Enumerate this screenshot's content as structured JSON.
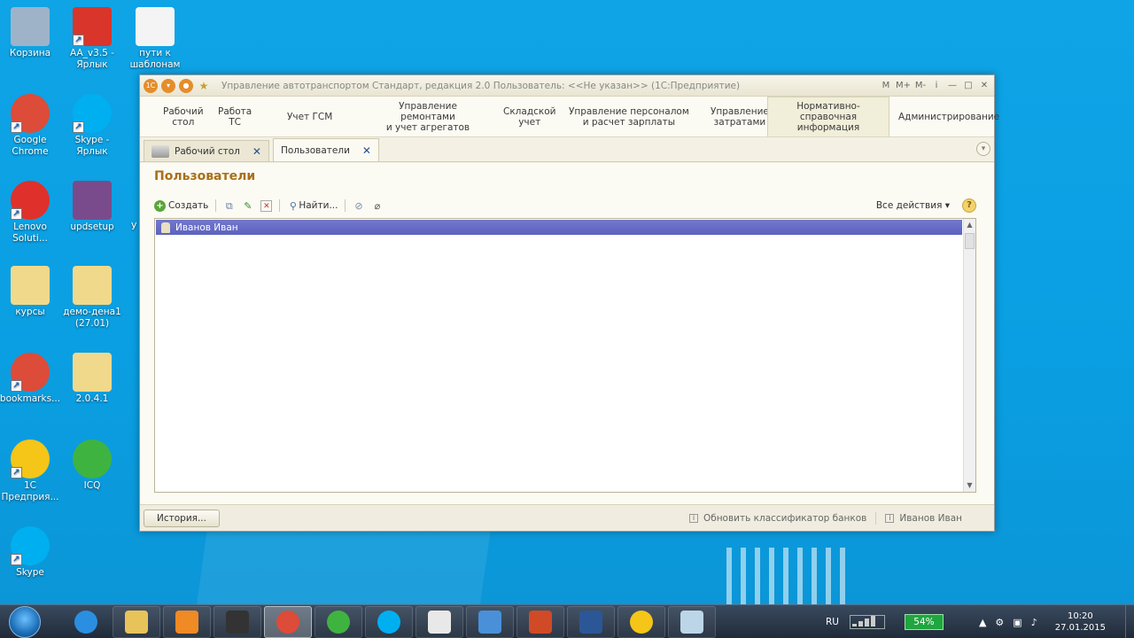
{
  "desktop": {
    "icons": [
      {
        "id": "recycle",
        "label": "Корзина",
        "color": "#9fb3c8"
      },
      {
        "id": "aa",
        "label": "AA_v3.5 -\nЯрлык",
        "color": "#d9352b"
      },
      {
        "id": "paths",
        "label": "пути к\nшаблонам",
        "color": "#f4f4f4"
      },
      {
        "id": "chrome",
        "label": "Google\nChrome",
        "color": "#dd4b39"
      },
      {
        "id": "skype1",
        "label": "Skype -\nЯрлык",
        "color": "#00aff0"
      },
      {
        "id": "lenovo",
        "label": "Lenovo\nSoluti...",
        "color": "#e0302c"
      },
      {
        "id": "updsetup",
        "label": "updsetup",
        "color": "#7a4b8c"
      },
      {
        "id": "kursy",
        "label": "курсы",
        "color": "#f1d98b"
      },
      {
        "id": "demo",
        "label": "демо-дена1\n(27.01)",
        "color": "#f1d98b"
      },
      {
        "id": "bookmarks",
        "label": "bookmarks...",
        "color": "#dd4b39"
      },
      {
        "id": "folder204",
        "label": "2.0.4.1",
        "color": "#f1d98b"
      },
      {
        "id": "onec",
        "label": "1С\nПредприя...",
        "color": "#f5c518"
      },
      {
        "id": "icq",
        "label": "ICQ",
        "color": "#3fb33f"
      },
      {
        "id": "skype2",
        "label": "Skype",
        "color": "#00aff0"
      }
    ],
    "partial_label": "У"
  },
  "window": {
    "title": "Управление автотранспортом Стандарт, редакция 2.0   Пользователь: <<Не указан>>  (1С:Предприятие)",
    "title_tools": [
      "M",
      "M+",
      "M-",
      "i",
      "—",
      "□",
      "✕"
    ],
    "sections": [
      {
        "label": "Рабочий\nстол",
        "active": false
      },
      {
        "label": "Работа\nТС",
        "active": false
      },
      {
        "label": "Учет ГСМ",
        "active": false
      },
      {
        "label": "Управление ремонтами\nи учет агрегатов",
        "active": false
      },
      {
        "label": "Складской\nучет",
        "active": false
      },
      {
        "label": "Управление персоналом\nи расчет зарплаты",
        "active": false
      },
      {
        "label": "Управление\nзатратами",
        "active": false
      },
      {
        "label": "Нормативно-справочная\nинформация",
        "active": true
      },
      {
        "label": "Администрирование",
        "active": false
      }
    ],
    "tabs": [
      {
        "label": "Рабочий стол",
        "active": false
      },
      {
        "label": "Пользователи",
        "active": true
      }
    ],
    "form": {
      "title": "Пользователи",
      "commands": {
        "create": "Создать",
        "find": "Найти...",
        "all_actions": "Все действия ▾",
        "help": "?"
      },
      "rows": [
        "Иванов Иван"
      ]
    },
    "status": {
      "history": "История...",
      "update_banks": "Обновить классификатор банков",
      "user": "Иванов Иван"
    }
  },
  "taskbar": {
    "apps": [
      {
        "id": "ie",
        "color": "#2a8fe0"
      },
      {
        "id": "explorer",
        "color": "#e8c35a"
      },
      {
        "id": "media",
        "color": "#f08a24"
      },
      {
        "id": "app-dark",
        "color": "#333333"
      },
      {
        "id": "chrome",
        "color": "#dd4b39"
      },
      {
        "id": "icq",
        "color": "#3fb33f"
      },
      {
        "id": "skype",
        "color": "#00aff0"
      },
      {
        "id": "calendar",
        "color": "#e8e8e8"
      },
      {
        "id": "snowflake",
        "color": "#4a90d9"
      },
      {
        "id": "powerpoint",
        "color": "#d04a26"
      },
      {
        "id": "word",
        "color": "#2b5797"
      },
      {
        "id": "onec",
        "color": "#f5c518"
      },
      {
        "id": "notepad",
        "color": "#bcd6e8"
      }
    ],
    "active_app": "chrome",
    "lang": "RU",
    "battery": "54%",
    "time": "10:20",
    "date": "27.01.2015"
  }
}
